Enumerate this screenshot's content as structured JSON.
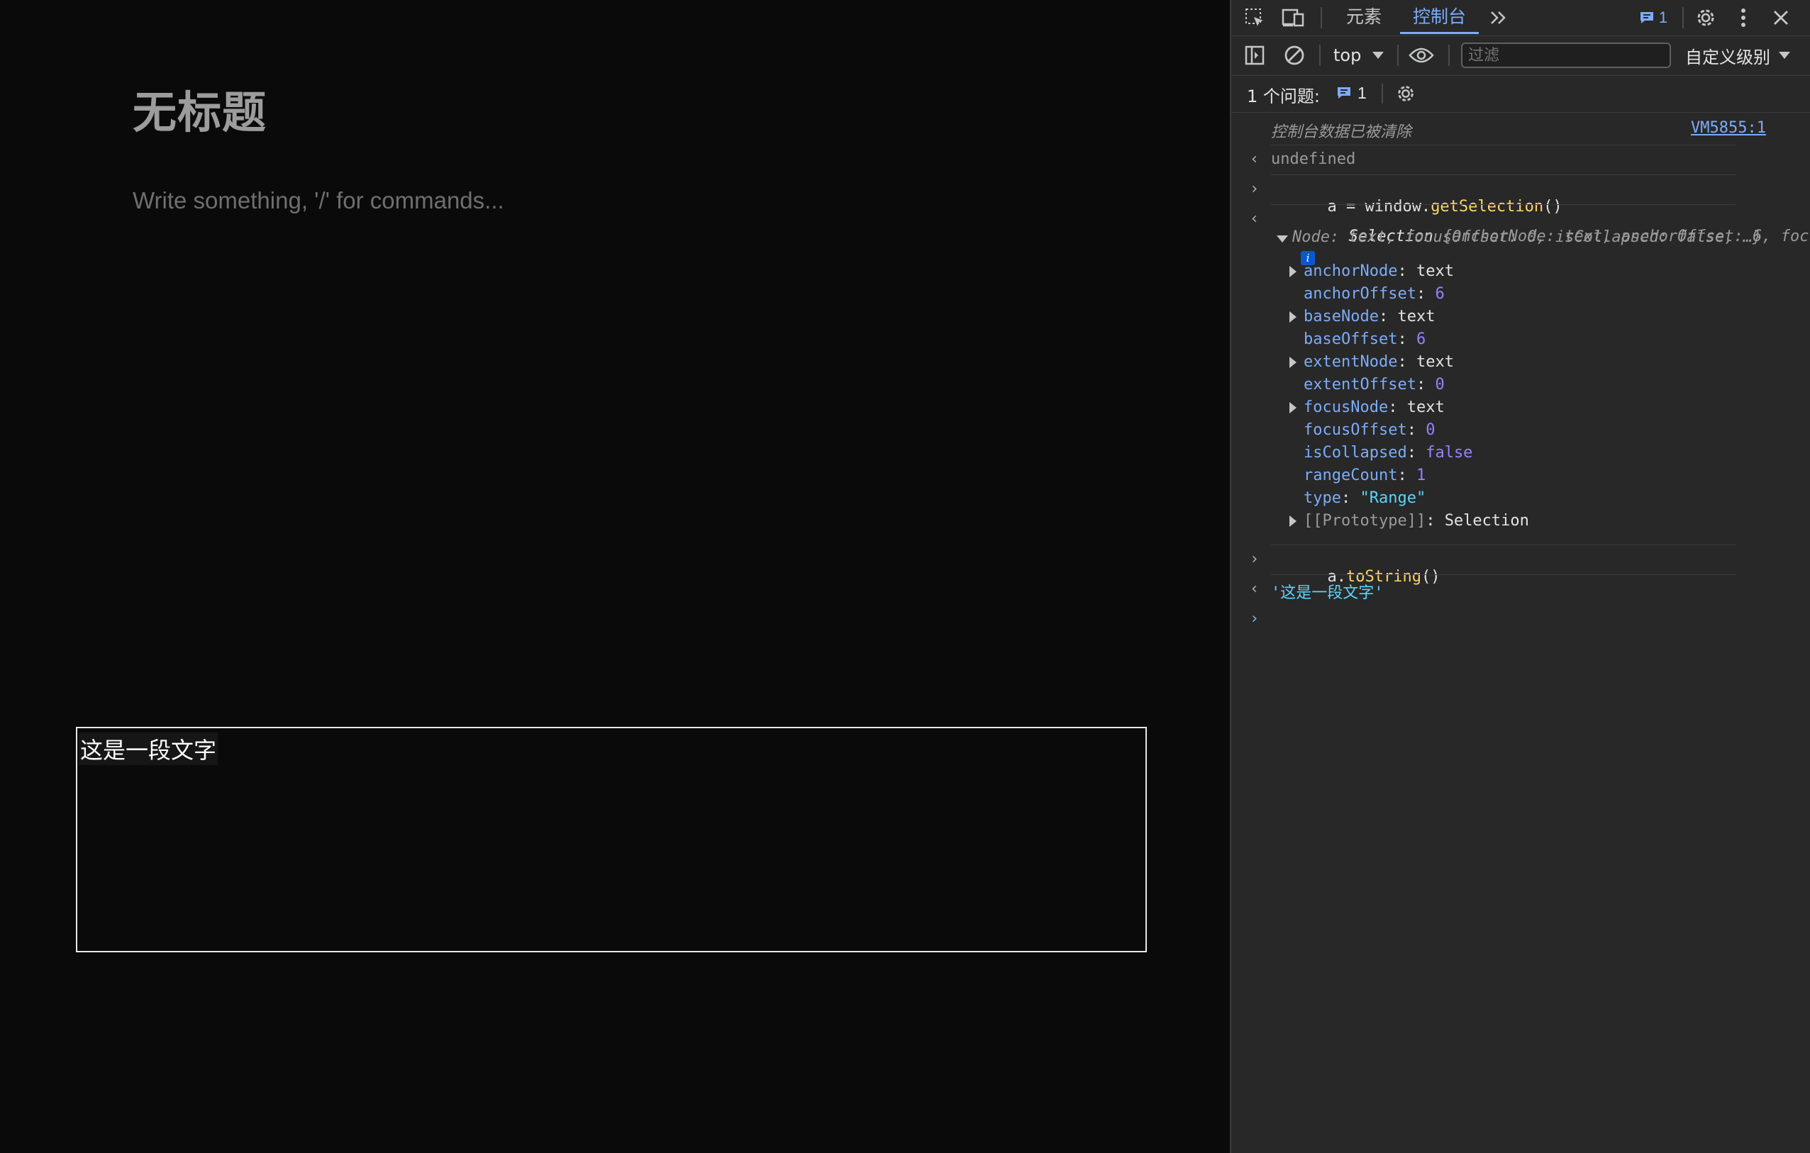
{
  "editor": {
    "title": "无标题",
    "placeholder": "Write something, '/' for commands...",
    "selected_text": "这是一段文字"
  },
  "devtools": {
    "tabs": {
      "elements": "元素",
      "console": "控制台"
    },
    "badge_count": "1",
    "context": "top",
    "filter_placeholder": "过滤",
    "level": "自定义级别",
    "issues_label": "1 个问题:",
    "issues_count": "1"
  },
  "console": {
    "cleared_msg": "控制台数据已被清除",
    "cleared_source": "VM5855:1",
    "undefined": "undefined",
    "cmd1_var": "a = window.",
    "cmd1_fn": "getSelection",
    "cmd1_paren": "()",
    "summary_prefix": "Selection ",
    "summary_line1": "{anchorNode: text, anchorOffset: 6, focus",
    "summary_line2": "Node: text, focusOffset: 0, isCollapsed: false, …}",
    "props": [
      {
        "key": "anchorNode",
        "value": "text",
        "kind": "plain",
        "expandable": true
      },
      {
        "key": "anchorOffset",
        "value": "6",
        "kind": "num",
        "expandable": false
      },
      {
        "key": "baseNode",
        "value": "text",
        "kind": "plain",
        "expandable": true
      },
      {
        "key": "baseOffset",
        "value": "6",
        "kind": "num",
        "expandable": false
      },
      {
        "key": "extentNode",
        "value": "text",
        "kind": "plain",
        "expandable": true
      },
      {
        "key": "extentOffset",
        "value": "0",
        "kind": "num",
        "expandable": false
      },
      {
        "key": "focusNode",
        "value": "text",
        "kind": "plain",
        "expandable": true
      },
      {
        "key": "focusOffset",
        "value": "0",
        "kind": "num",
        "expandable": false
      },
      {
        "key": "isCollapsed",
        "value": "false",
        "kind": "num",
        "expandable": false
      },
      {
        "key": "rangeCount",
        "value": "1",
        "kind": "num",
        "expandable": false
      },
      {
        "key": "type",
        "value": "\"Range\"",
        "kind": "str",
        "expandable": false
      },
      {
        "key": "[[Prototype]]",
        "value": "Selection",
        "kind": "plain",
        "expandable": true
      }
    ],
    "cmd2_obj": "a.",
    "cmd2_fn": "toString",
    "cmd2_paren": "()",
    "result2": "'这是一段文字'"
  }
}
